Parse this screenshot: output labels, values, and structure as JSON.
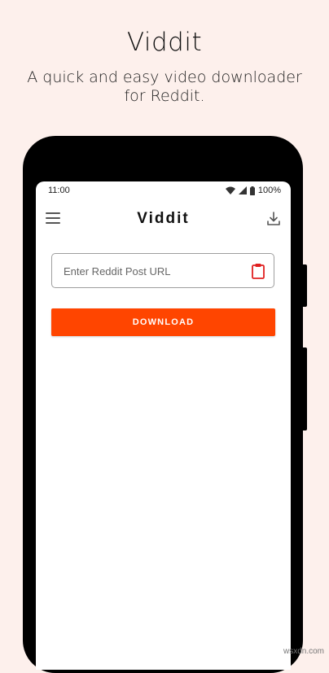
{
  "promo": {
    "title": "Viddit",
    "subtitle": "A quick and easy video downloader for Reddit."
  },
  "status_bar": {
    "time": "11:00",
    "battery": "100%"
  },
  "app_bar": {
    "title": "Viddit"
  },
  "url_input": {
    "placeholder": "Enter Reddit Post URL",
    "value": ""
  },
  "download_button": {
    "label": "DOWNLOAD"
  },
  "watermark": "wsxdn.com",
  "colors": {
    "accent": "#ff4500",
    "background": "#fdf0ec"
  },
  "icons": [
    "menu-icon",
    "download-icon",
    "clipboard-icon",
    "wifi-icon",
    "signal-icon",
    "battery-icon"
  ]
}
